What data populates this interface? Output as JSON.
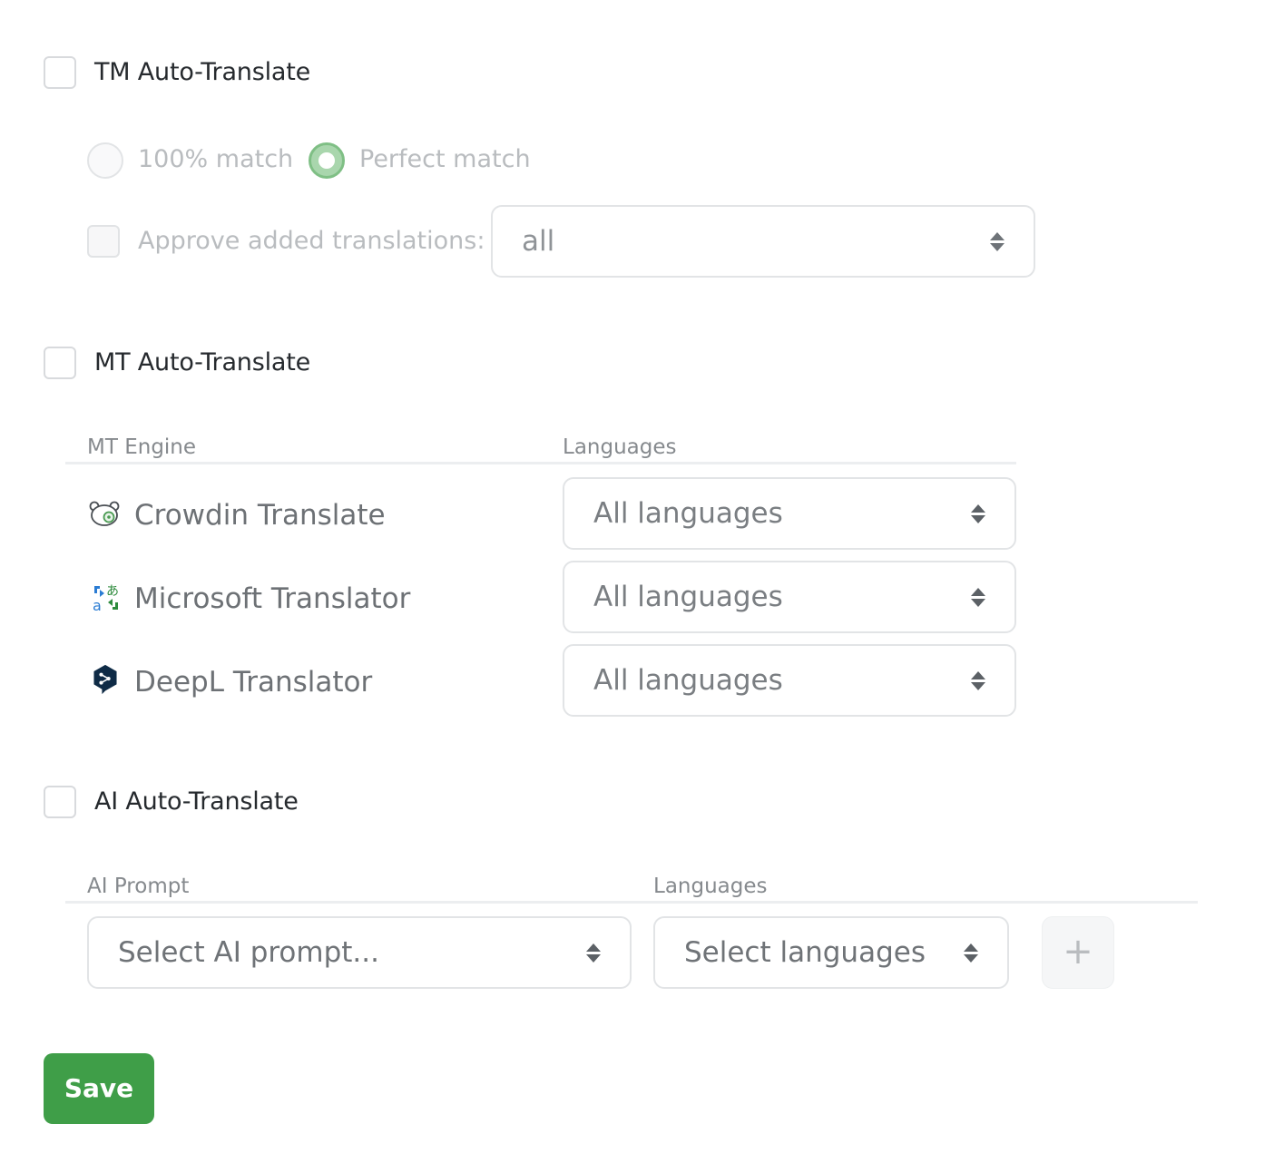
{
  "tm": {
    "title": "TM Auto-Translate",
    "checked": false,
    "match_options": [
      {
        "label": "100% match",
        "selected": false
      },
      {
        "label": "Perfect match",
        "selected": true
      }
    ],
    "approve_label": "Approve added translations:",
    "approve_value": "all"
  },
  "mt": {
    "title": "MT Auto-Translate",
    "checked": false,
    "engine_header": "MT Engine",
    "languages_header": "Languages",
    "engines": [
      {
        "name": "Crowdin Translate",
        "icon": "crowdin-icon",
        "languages": "All languages"
      },
      {
        "name": "Microsoft Translator",
        "icon": "microsoft-translator-icon",
        "languages": "All languages"
      },
      {
        "name": "DeepL Translator",
        "icon": "deepl-icon",
        "languages": "All languages"
      }
    ]
  },
  "ai": {
    "title": "AI Auto-Translate",
    "checked": false,
    "prompt_header": "AI Prompt",
    "languages_header": "Languages",
    "prompt_placeholder": "Select AI prompt...",
    "languages_placeholder": "Select languages",
    "add_label": "+"
  },
  "actions": {
    "save_label": "Save"
  },
  "colors": {
    "accent": "#3f9e48",
    "radio_selected": "#a9d6ad"
  }
}
